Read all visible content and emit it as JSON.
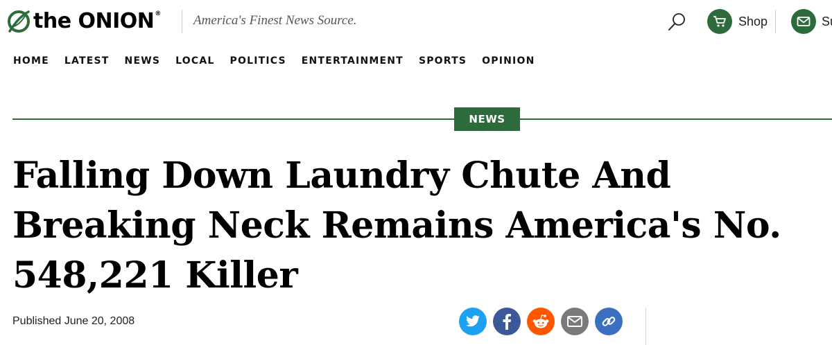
{
  "header": {
    "logo_text": "the ONION",
    "logo_reg": "®",
    "tagline": "America's Finest News Source.",
    "search_icon": "search-icon",
    "shop_label": "Shop",
    "shop_icon": "cart-icon",
    "subscribe_label": "Su",
    "subscribe_icon": "envelope-icon"
  },
  "nav": {
    "items": [
      "HOME",
      "LATEST",
      "NEWS",
      "LOCAL",
      "POLITICS",
      "ENTERTAINMENT",
      "SPORTS",
      "OPINION"
    ]
  },
  "article": {
    "section_tag": "NEWS",
    "headline": "Falling Down Laundry Chute And Breaking Neck Remains America's No. 548,221 Killer",
    "published": "Published June 20, 2008"
  },
  "share": [
    {
      "name": "twitter-share-button",
      "icon": "twitter-icon",
      "color": "#1da1f2"
    },
    {
      "name": "facebook-share-button",
      "icon": "facebook-icon",
      "color": "#3b5998"
    },
    {
      "name": "reddit-share-button",
      "icon": "reddit-icon",
      "color": "#ff5700"
    },
    {
      "name": "email-share-button",
      "icon": "email-icon",
      "color": "#7a7a7a"
    },
    {
      "name": "copy-link-button",
      "icon": "link-icon",
      "color": "#3b6fc0"
    }
  ],
  "colors": {
    "brand_green": "#2e6b3c"
  }
}
